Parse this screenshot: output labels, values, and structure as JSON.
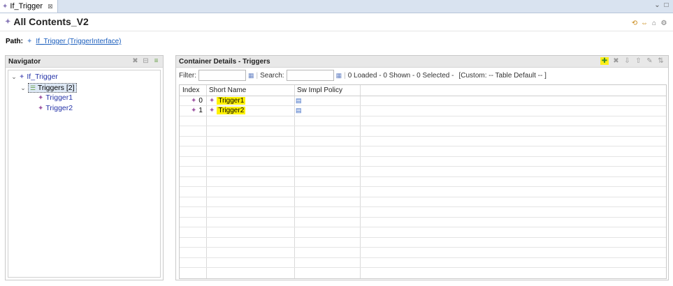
{
  "tab": {
    "label": "If_Trigger",
    "close": "⊠"
  },
  "window": {
    "minimize": "⌄",
    "maximize": "□"
  },
  "header": {
    "title": "All Contents_V2"
  },
  "path": {
    "label": "Path:",
    "link": "If_Trigger (TriggerInterface)"
  },
  "navigator": {
    "title": "Navigator",
    "tree": [
      {
        "label": "If_Trigger",
        "expanded": true,
        "level": 0
      },
      {
        "label": "Triggers [2]",
        "expanded": true,
        "level": 1,
        "selected": true
      },
      {
        "label": "Trigger1",
        "level": 2
      },
      {
        "label": "Trigger2",
        "level": 2
      }
    ]
  },
  "container": {
    "title": "Container Details - Triggers",
    "filter_label": "Filter:",
    "search_label": "Search:",
    "status": "0 Loaded - 0 Shown - 0 Selected -",
    "custom": "[Custom: -- Table Default -- ]",
    "columns": [
      "Index",
      "Short Name",
      "Sw Impl Policy"
    ],
    "rows": [
      {
        "index": "0",
        "name": "Trigger1"
      },
      {
        "index": "1",
        "name": "Trigger2"
      }
    ]
  },
  "colors": {
    "highlight": "#fff200",
    "link": "#1b5ebd",
    "tree_text": "#2433a8"
  }
}
